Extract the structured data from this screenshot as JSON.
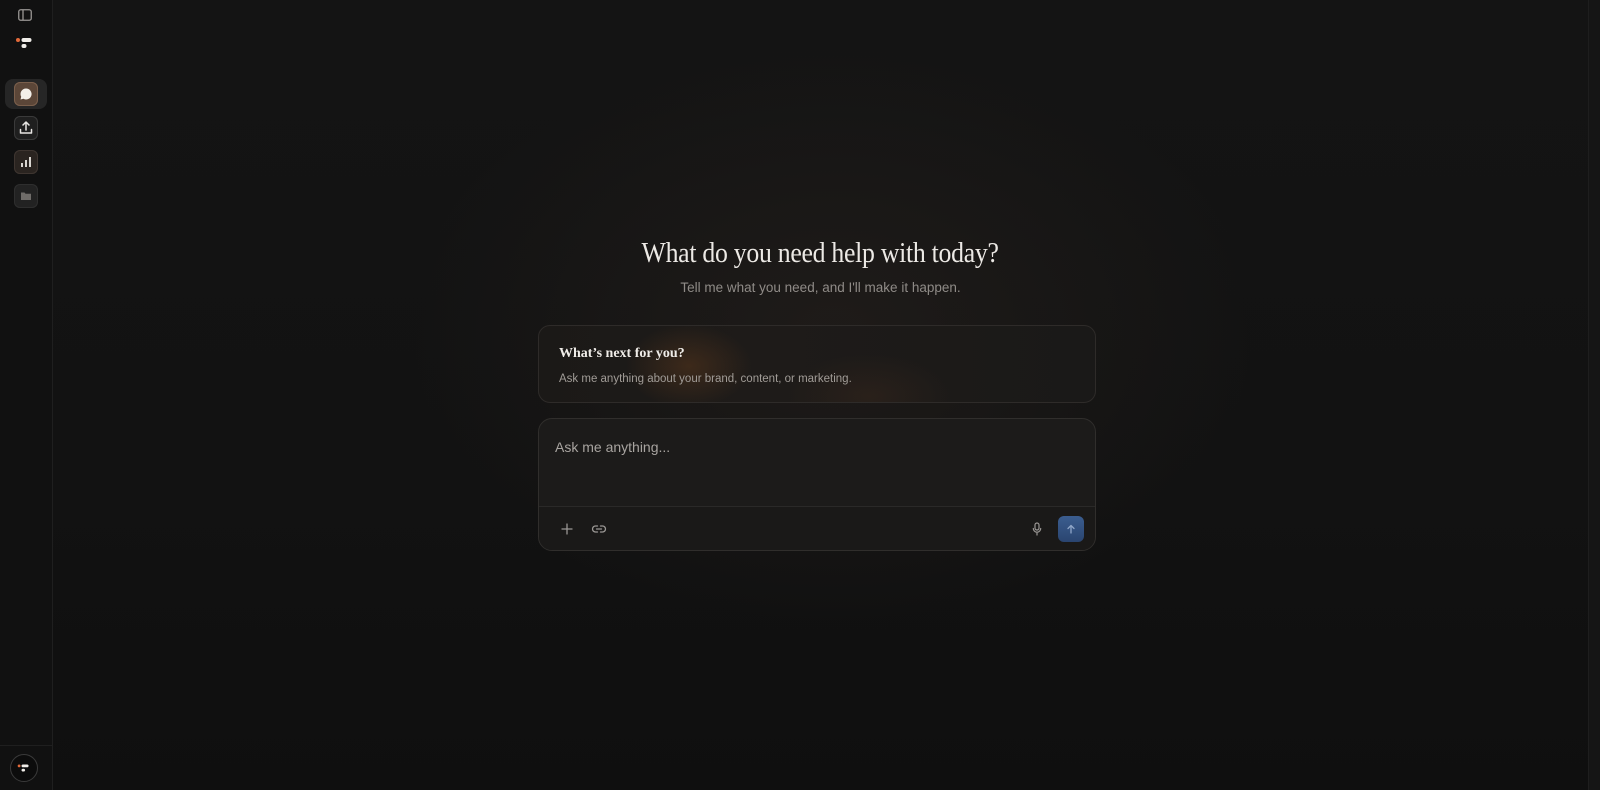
{
  "hero": {
    "title": "What do you need help with today?",
    "subtitle": "Tell me what you need, and I'll make it happen."
  },
  "promo": {
    "title": "What’s next for you?",
    "text": "Ask me anything about your brand, content, or marketing."
  },
  "composer": {
    "placeholder": "Ask me anything...",
    "value": ""
  },
  "sidebar": {
    "items": [
      {
        "icon": "chat-bubble-icon",
        "active": true
      },
      {
        "icon": "upload-icon",
        "active": false
      },
      {
        "icon": "bar-chart-icon",
        "active": false
      },
      {
        "icon": "folder-icon",
        "active": false
      }
    ]
  },
  "colors": {
    "background": "#121212",
    "sidebar": "#111111",
    "accent_chat_tile": "#5b4638",
    "send_button": "#3b5d8f"
  }
}
